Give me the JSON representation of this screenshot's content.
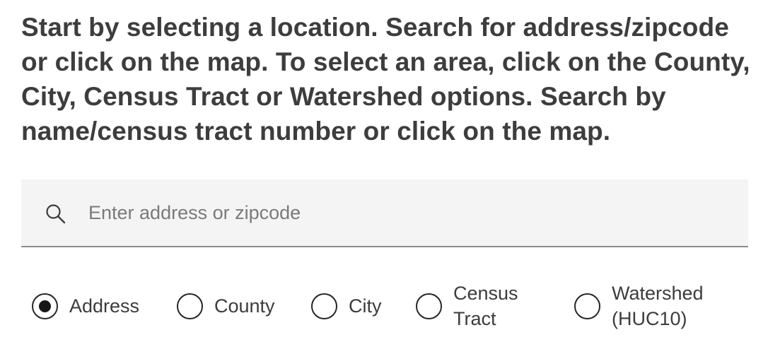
{
  "instructions": {
    "text": "Start by selecting a location. Search for address/zipcode or click on the map. To select an area, click on the County, City, Census Tract or Watershed options. Search by name/census tract number or click on the map."
  },
  "search": {
    "icon": "search-icon",
    "placeholder": "Enter address or zipcode",
    "value": ""
  },
  "location_types": {
    "selected": "Address",
    "options": [
      {
        "label": "Address",
        "selected": true
      },
      {
        "label": "County",
        "selected": false
      },
      {
        "label": "City",
        "selected": false
      },
      {
        "label": "Census Tract",
        "selected": false
      },
      {
        "label": "Watershed (HUC10)",
        "selected": false
      }
    ]
  }
}
